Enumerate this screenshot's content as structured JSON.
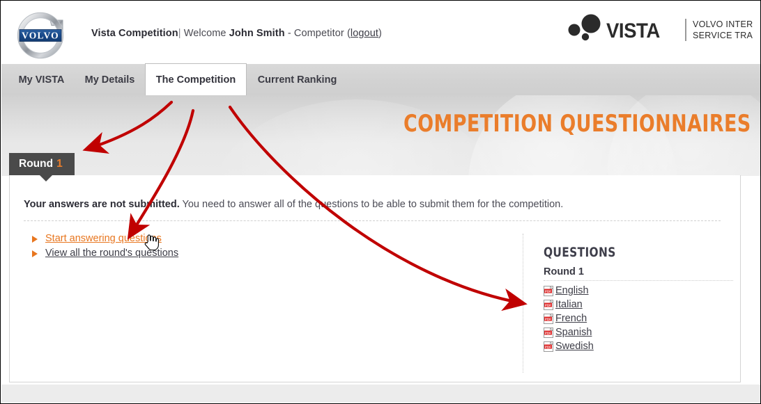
{
  "header": {
    "logo_alt": "VOLVO",
    "site_title": "Vista Competition",
    "separator": "|",
    "welcome_prefix": "Welcome",
    "user_name": "John Smith",
    "role": "- Competitor",
    "logout_open": "(",
    "logout": "logout",
    "logout_close": ")",
    "brand_name": "VISTA",
    "brand_line1": "VOLVO INTERNATIONAL",
    "brand_line2": "SERVICE TRAINING AWARD"
  },
  "tabs": [
    {
      "label": "My VISTA",
      "active": false
    },
    {
      "label": "My Details",
      "active": false
    },
    {
      "label": "The Competition",
      "active": true
    },
    {
      "label": "Current Ranking",
      "active": false
    }
  ],
  "banner": {
    "title": "COMPETITION QUESTIONNAIRES"
  },
  "round_tab": {
    "label": "Round",
    "number": "1"
  },
  "content": {
    "notice_bold": "Your answers are not submitted.",
    "notice_rest": " You need to answer all of the questions to be able to submit them for the competition.",
    "links": [
      {
        "label": "Start answering questions",
        "style": "orange"
      },
      {
        "label": "View all the round's questions",
        "style": "dark"
      }
    ]
  },
  "questions": {
    "title": "QUESTIONS",
    "round_label": "Round 1",
    "items": [
      {
        "label": "English",
        "icon": "pdf-icon"
      },
      {
        "label": "Italian",
        "icon": "pdf-icon"
      },
      {
        "label": "French",
        "icon": "pdf-icon"
      },
      {
        "label": "Spanish",
        "icon": "pdf-icon"
      },
      {
        "label": "Swedish",
        "icon": "pdf-icon"
      }
    ]
  },
  "colors": {
    "accent_orange": "#ea7d2b",
    "link_orange": "#e8761f",
    "round_tab_bg": "#4a4a4a",
    "annotation_red": "#c00000",
    "volvo_blue": "#1b4a8c"
  },
  "annotations": {
    "arrow_count": 3,
    "cursor": "hand-pointer"
  }
}
